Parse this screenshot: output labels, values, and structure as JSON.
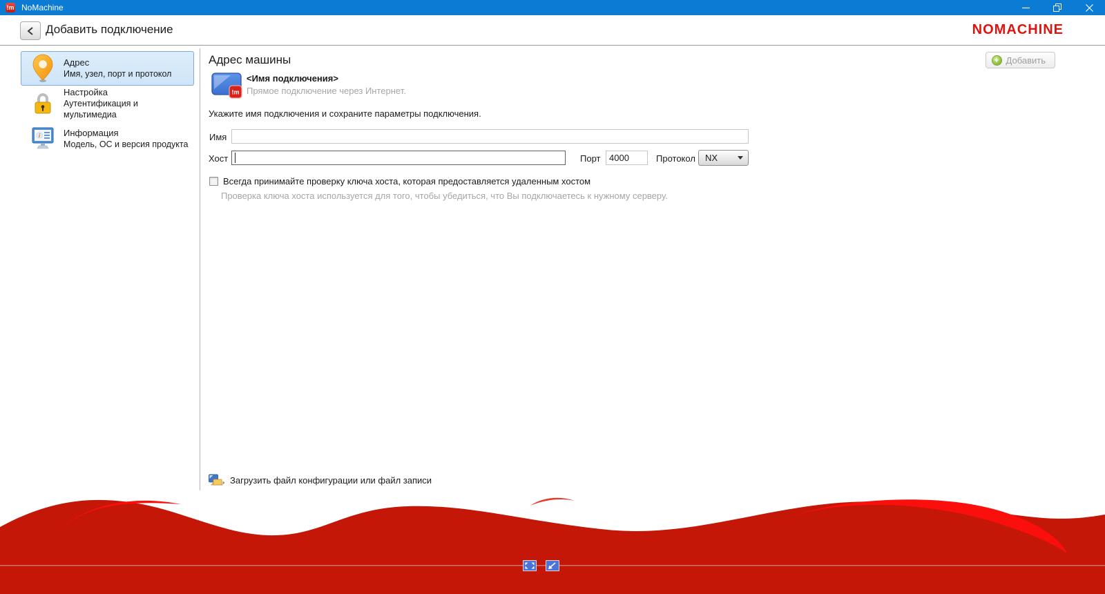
{
  "titlebar": {
    "app_title": "NoMachine",
    "app_icon_text": "!m"
  },
  "header": {
    "title": "Добавить подключение",
    "brand": "NOMACHINE"
  },
  "sidebar": {
    "items": [
      {
        "title": "Адрес",
        "subtitle": "Имя, узел, порт и протокол",
        "icon": "map-pin-icon",
        "selected": true
      },
      {
        "title": "Настройка",
        "subtitle": "Аутентификация и мультимедиа",
        "icon": "lock-icon",
        "selected": false
      },
      {
        "title": "Информация",
        "subtitle": "Модель, ОС и версия продукта",
        "icon": "monitor-info-icon",
        "selected": false
      }
    ]
  },
  "main": {
    "heading": "Адрес машины",
    "add_button_label": "Добавить",
    "connection": {
      "badge_text": "!m",
      "name_display": "<Имя подключения>",
      "description": "Прямое подключение через Интернет."
    },
    "instruction": "Укажите имя подключения и сохраните параметры подключения.",
    "form": {
      "name_label": "Имя",
      "name_value": "",
      "host_label": "Хост",
      "host_value": "",
      "port_label": "Порт",
      "port_value": "4000",
      "protocol_label": "Протокол",
      "protocol_value": "NX"
    },
    "host_key_checkbox": {
      "checked": false,
      "label": "Всегда принимайте проверку ключа хоста, которая предоставляется удаленным хостом",
      "hint": "Проверка ключа хоста используется для того, чтобы убедиться, что Вы подключаетесь к нужному серверу."
    },
    "load_link_label": "Загрузить файл конфигурации или файл записи"
  },
  "footer": {
    "icons": [
      "fullscreen-expand-icon",
      "fullscreen-collapse-icon"
    ]
  },
  "colors": {
    "titlebar_blue": "#0b7bd3",
    "brand_red": "#e0140e",
    "wave_red": "#c41707",
    "wave_highlight": "#fb0f0c",
    "selected_item_bg": "#d6e8f9",
    "selected_item_border": "#7fabdd",
    "text_dark": "#1b1b1b",
    "text_gray": "#a6a6a6"
  }
}
